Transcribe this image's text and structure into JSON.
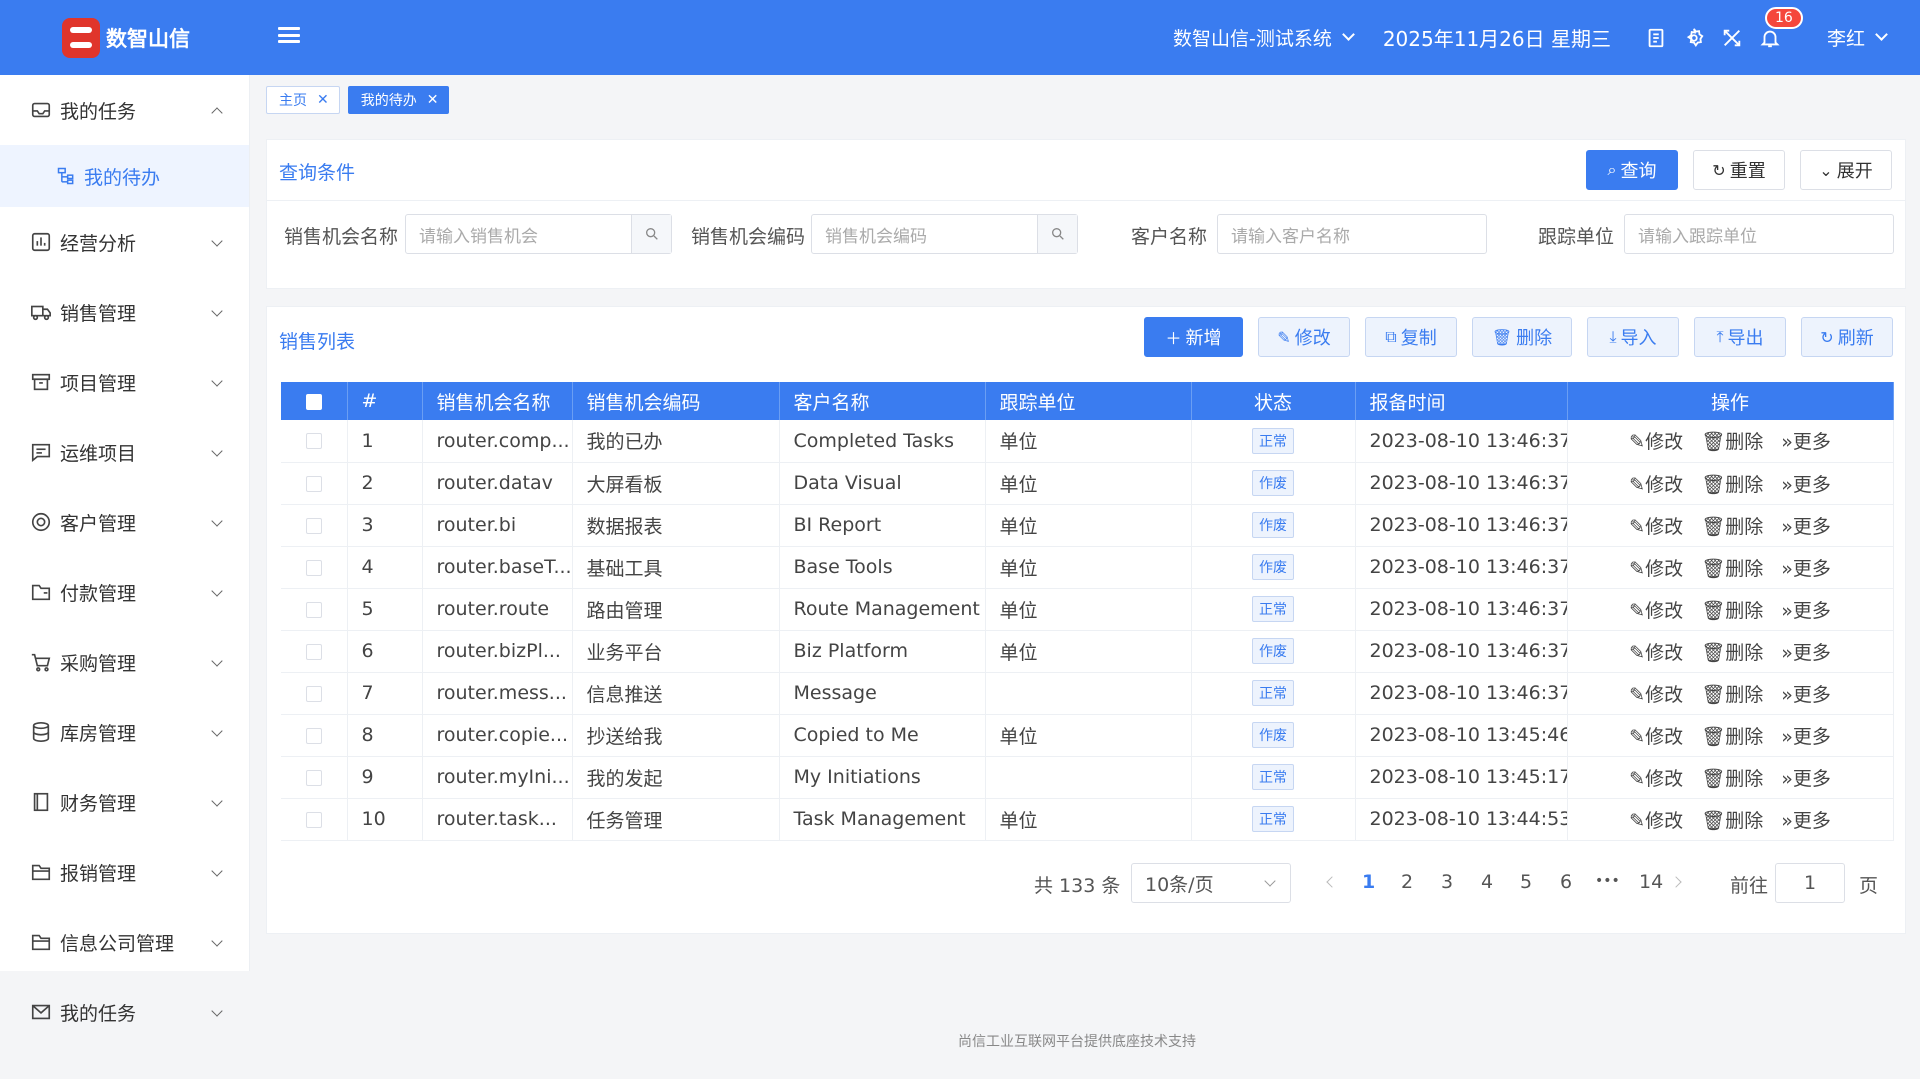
{
  "header": {
    "logo_text": "数智山信",
    "system_name": "数智山信-测试系统",
    "date": "2025年11月26日 星期三",
    "notify_count": "16",
    "user": "李红",
    "accent": "#3a7cf0"
  },
  "sidebar": {
    "items": [
      {
        "label": "我的任务",
        "icon": "inbox-icon",
        "expanded": true
      },
      {
        "label": "经营分析",
        "icon": "chart-icon"
      },
      {
        "label": "销售管理",
        "icon": "truck-icon"
      },
      {
        "label": "项目管理",
        "icon": "box-icon"
      },
      {
        "label": "运维项目",
        "icon": "message-icon"
      },
      {
        "label": "客户管理",
        "icon": "user-circle-icon"
      },
      {
        "label": "付款管理",
        "icon": "folder-icon"
      },
      {
        "label": "采购管理",
        "icon": "cart-icon"
      },
      {
        "label": "库房管理",
        "icon": "database-icon"
      },
      {
        "label": "财务管理",
        "icon": "book-icon"
      },
      {
        "label": "报销管理",
        "icon": "folder-open-icon"
      },
      {
        "label": "信息公司管理",
        "icon": "folder-open-icon"
      },
      {
        "label": "我的任务",
        "icon": "mail-icon"
      }
    ],
    "sub_item": "我的待办"
  },
  "tabs": [
    {
      "label": "主页"
    },
    {
      "label": "我的待办",
      "active": true
    }
  ],
  "query": {
    "title": "查询条件",
    "search_btn": "查询",
    "reset_btn": "重置",
    "expand_btn": "展开",
    "fields": [
      {
        "label": "销售机会名称",
        "placeholder": "请输入销售机会"
      },
      {
        "label": "销售机会编码",
        "placeholder": "销售机会编码"
      },
      {
        "label": "客户名称",
        "placeholder": "请输入客户名称"
      },
      {
        "label": "跟踪单位",
        "placeholder": "请输入跟踪单位"
      }
    ]
  },
  "list": {
    "title": "销售列表",
    "buttons": {
      "add": "新增",
      "edit": "修改",
      "copy": "复制",
      "delete": "删除",
      "import": "导入",
      "export": "导出",
      "refresh": "刷新"
    },
    "columns": [
      "#",
      "销售机会名称",
      "销售机会编码",
      "客户名称",
      "跟踪单位",
      "状态",
      "报备时间",
      "操作"
    ],
    "op_labels": {
      "edit": "修改",
      "delete": "删除",
      "more": "更多"
    },
    "rows": [
      {
        "no": "1",
        "name": "router.comp...",
        "code": "我的已办",
        "customer": "Completed Tasks",
        "unit": "单位",
        "status": "正常",
        "time": "2023-08-10 13:46:37"
      },
      {
        "no": "2",
        "name": "router.datav",
        "code": "大屏看板",
        "customer": "Data Visual",
        "unit": "单位",
        "status": "作废",
        "time": "2023-08-10 13:46:37"
      },
      {
        "no": "3",
        "name": "router.bi",
        "code": "数据报表",
        "customer": "BI Report",
        "unit": "单位",
        "status": "作废",
        "time": "2023-08-10 13:46:37"
      },
      {
        "no": "4",
        "name": "router.baseT...",
        "code": "基础工具",
        "customer": "Base Tools",
        "unit": "单位",
        "status": "作废",
        "time": "2023-08-10 13:46:37"
      },
      {
        "no": "5",
        "name": "router.route",
        "code": "路由管理",
        "customer": "Route Management",
        "unit": "单位",
        "status": "正常",
        "time": "2023-08-10 13:46:37"
      },
      {
        "no": "6",
        "name": "router.bizPl...",
        "code": "业务平台",
        "customer": "Biz Platform",
        "unit": "单位",
        "status": "作废",
        "time": "2023-08-10 13:46:37"
      },
      {
        "no": "7",
        "name": "router.mess...",
        "code": "信息推送",
        "customer": "Message",
        "unit": "",
        "status": "正常",
        "time": "2023-08-10 13:46:37"
      },
      {
        "no": "8",
        "name": "router.copie...",
        "code": "抄送给我",
        "customer": "Copied to Me",
        "unit": "单位",
        "status": "作废",
        "time": "2023-08-10 13:45:46"
      },
      {
        "no": "9",
        "name": "router.myIni...",
        "code": "我的发起",
        "customer": "My Initiations",
        "unit": "",
        "status": "正常",
        "time": "2023-08-10 13:45:17"
      },
      {
        "no": "10",
        "name": "router.task...",
        "code": "任务管理",
        "customer": "Task Management",
        "unit": "单位",
        "status": "正常",
        "time": "2023-08-10 13:44:53"
      }
    ]
  },
  "pagination": {
    "total": "共 133 条",
    "page_size": "10条/页",
    "pages": [
      "1",
      "2",
      "3",
      "4",
      "5",
      "6",
      "•••",
      "14"
    ],
    "current": "1",
    "goto_label": "前往",
    "goto_value": "1",
    "page_suffix": "页"
  },
  "footer": "尚信工业互联网平台提供底座技术支持"
}
